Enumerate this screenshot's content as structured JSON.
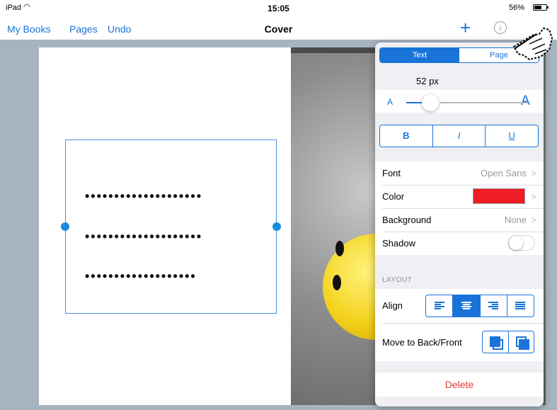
{
  "status_bar": {
    "device": "iPad",
    "time": "15:05",
    "battery": "56%"
  },
  "nav": {
    "my_books": "My Books",
    "pages": "Pages",
    "undo": "Undo",
    "title": "Cover"
  },
  "canvas": {
    "text_lines": [
      "••••••••••••••••••••",
      "••••••••••••••••••••",
      "•••••••••••••••••••"
    ]
  },
  "inspector": {
    "tabs": [
      "Text",
      "Page"
    ],
    "selected_tab": "Text",
    "font_size": "52 px",
    "size_small_label": "A",
    "size_large_label": "A",
    "font_size_slider": 0.2,
    "style_buttons": [
      "B",
      "I",
      "U"
    ],
    "font_label": "Font",
    "font_value": "Open Sans",
    "color_label": "Color",
    "color_value": "#ee1c24",
    "background_label": "Background",
    "background_value": "None",
    "shadow_label": "Shadow",
    "shadow_on": false,
    "layout_header": "LAYOUT",
    "align_label": "Align",
    "align_options": [
      "left",
      "center",
      "right",
      "justify"
    ],
    "align_selected": "center",
    "order_label": "Move to Back/Front",
    "delete_label": "Delete"
  },
  "colors": {
    "accent": "#1a73d9",
    "delete": "#e53935",
    "canvas_background": "#a7b4c0"
  }
}
